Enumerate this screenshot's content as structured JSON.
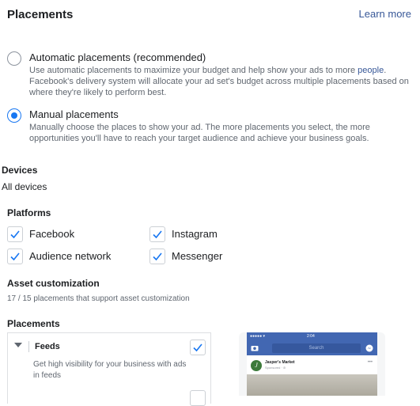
{
  "header": {
    "title": "Placements",
    "learn_more": "Learn more"
  },
  "options": {
    "automatic": {
      "title": "Automatic placements (recommended)",
      "desc_1": "Use automatic placements to maximize your budget and help show your ads to more ",
      "desc_link": "people",
      "desc_2": ".",
      "desc_line2": "Facebook's delivery system will allocate your ad set's budget across multiple placements based on",
      "desc_line3": "where they're likely to perform best."
    },
    "manual": {
      "title": "Manual placements",
      "desc_line1": "Manually choose the places to show your ad. The more placements you select, the more",
      "desc_line2": "opportunities you'll have to reach your target audience and achieve your business goals."
    },
    "selected": "manual"
  },
  "devices": {
    "label": "Devices",
    "value": "All devices"
  },
  "platforms": {
    "label": "Platforms",
    "items": [
      {
        "label": "Facebook",
        "checked": true
      },
      {
        "label": "Instagram",
        "checked": true
      },
      {
        "label": "Audience network",
        "checked": true
      },
      {
        "label": "Messenger",
        "checked": true
      }
    ]
  },
  "asset_customization": {
    "label": "Asset customization",
    "summary": "17 / 15 placements that support asset customization"
  },
  "placements_list": {
    "label": "Placements",
    "feeds": {
      "title": "Feeds",
      "desc": "Get high visibility for your business with ads in feeds",
      "checked": true
    }
  },
  "preview": {
    "status_time": "2:04",
    "search_placeholder": "Search",
    "page_name": "Jasper's Market",
    "sponsored": "Sponsored · ⊘",
    "avatar_letter": "J"
  },
  "colors": {
    "accent": "#1877f2",
    "link": "#385898",
    "fb_blue": "#4267b2"
  }
}
